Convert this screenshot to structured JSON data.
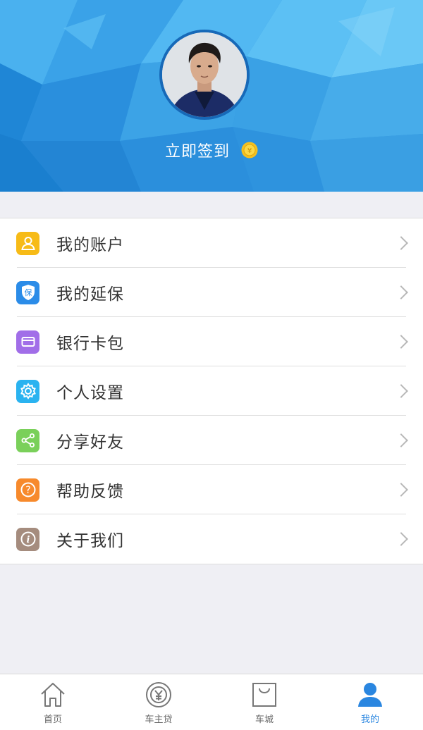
{
  "header": {
    "checkin_label": "立即签到",
    "coin_icon": "coin-icon",
    "avatar": "user-avatar"
  },
  "menu": [
    {
      "label": "我的账户",
      "icon": "person-icon",
      "color": "#f7bb17"
    },
    {
      "label": "我的延保",
      "icon": "shield-icon",
      "color": "#2b8ce8"
    },
    {
      "label": "银行卡包",
      "icon": "card-icon",
      "color": "#a16ee8"
    },
    {
      "label": "个人设置",
      "icon": "gear-icon",
      "color": "#2ab3f0"
    },
    {
      "label": "分享好友",
      "icon": "share-icon",
      "color": "#7ad05a"
    },
    {
      "label": "帮助反馈",
      "icon": "help-icon",
      "color": "#f78a2c"
    },
    {
      "label": "关于我们",
      "icon": "info-icon",
      "color": "#a58c7e"
    }
  ],
  "tabbar": {
    "tabs": [
      {
        "label": "首页",
        "icon": "home-icon",
        "active": false
      },
      {
        "label": "车主贷",
        "icon": "loan-icon",
        "active": false
      },
      {
        "label": "车城",
        "icon": "shopping-bag-icon",
        "active": false
      },
      {
        "label": "我的",
        "icon": "profile-icon",
        "active": true
      }
    ],
    "active_color": "#2a86e0",
    "inactive_color": "#666666"
  },
  "shield_glyph": "保",
  "info_glyph": "i",
  "help_glyph": "?"
}
